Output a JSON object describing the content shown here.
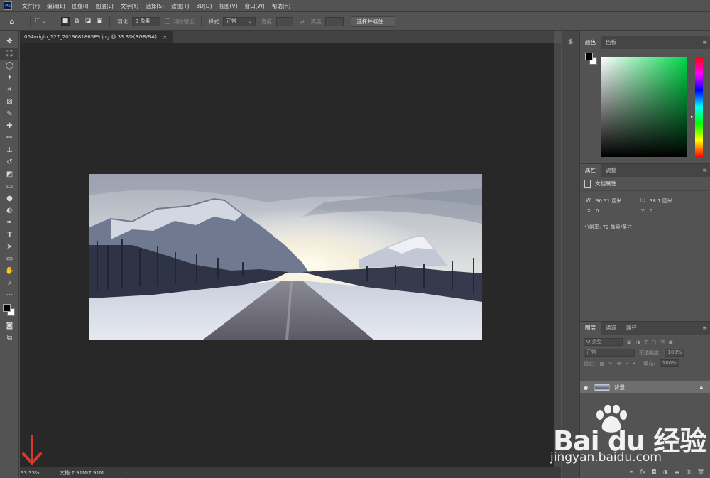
{
  "app": {
    "logo": "Ps"
  },
  "menu": [
    "文件(F)",
    "编辑(E)",
    "图像(I)",
    "图层(L)",
    "文字(Y)",
    "选择(S)",
    "滤镜(T)",
    "3D(D)",
    "视图(V)",
    "窗口(W)",
    "帮助(H)"
  ],
  "options": {
    "feather_label": "羽化:",
    "feather_value": "0 像素",
    "antialias_label": "消除锯齿",
    "style_label": "样式:",
    "style_value": "正常",
    "width_label": "宽度:",
    "height_label": "高度:",
    "select_mask_button": "选择并遮住 ..."
  },
  "document": {
    "tab_title": "064origin_127_2019681865E9.jpg @ 33.3%(RGB/8#)",
    "close_glyph": "×"
  },
  "status": {
    "zoom": "33.33%",
    "doc_size": "文档:7.91M/7.91M",
    "arrow": "›"
  },
  "color_panel": {
    "tabs": [
      "颜色",
      "色板"
    ]
  },
  "properties_panel": {
    "tabs": [
      "属性",
      "调整"
    ],
    "title": "文档属性",
    "w_label": "W:",
    "w_value": "90.31 厘米",
    "h_label": "H:",
    "h_value": "38.1 厘米",
    "x_label": "X:",
    "x_value": "0",
    "y_label": "Y:",
    "y_value": "0",
    "resolution": "分辨率: 72 像素/英寸"
  },
  "layers_panel": {
    "tabs": [
      "图层",
      "通道",
      "路径"
    ],
    "filter_placeholder": "Q 类型",
    "blend_mode": "正常",
    "opacity_label": "不透明度:",
    "opacity_value": "100%",
    "lock_label": "锁定:",
    "fill_label": "填充:",
    "fill_value": "100%",
    "layer_name": "背景",
    "fx_label": "fx"
  },
  "watermark": {
    "brand": "Bai du 经验",
    "url": "jingyan.baidu.com"
  },
  "colors": {
    "accent": "#31a8ff",
    "canvas": "#282828",
    "ui": "#535353",
    "arrow": "#d33a2c"
  }
}
